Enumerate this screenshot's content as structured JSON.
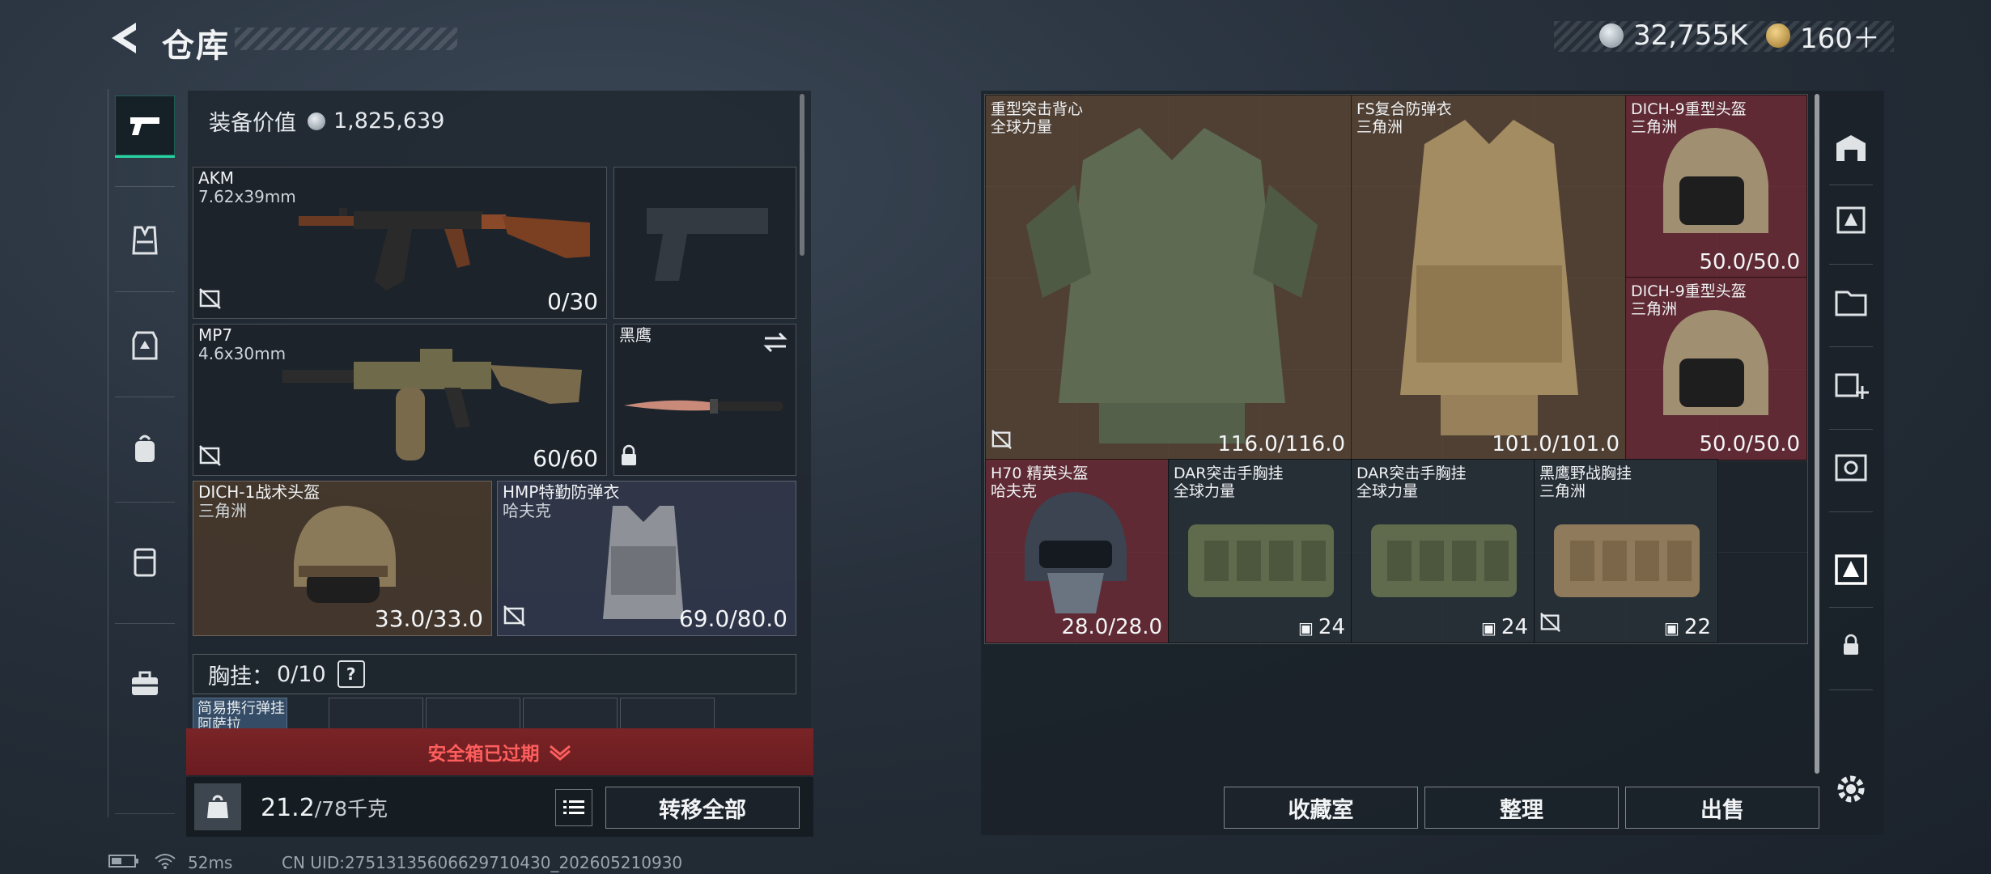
{
  "header": {
    "title": "仓库",
    "silver_amount": "32,755K",
    "gold_amount": "160＋"
  },
  "left_nav": {
    "items": [
      "gun-icon",
      "vest-icon",
      "armor-icon",
      "backpack-icon",
      "case-icon",
      "toolbox-icon"
    ],
    "active": "gun-icon"
  },
  "equipment": {
    "value_label": "装备价值",
    "value": "1,825,639",
    "primary": {
      "name": "AKM",
      "caliber": "7.62x39mm",
      "ammo": "0/30"
    },
    "secondary": {
      "name": "MP7",
      "caliber": "4.6x30mm",
      "ammo": "60/60"
    },
    "knife": {
      "name": "黑鹰"
    },
    "helmet": {
      "name": "DICH-1战术头盔",
      "faction": "三角洲",
      "durability": "33.0/33.0"
    },
    "armor": {
      "name": "HMP特勤防弹衣",
      "faction": "哈夫克",
      "durability": "69.0/80.0"
    },
    "chest_rig": {
      "label": "胸挂：",
      "count": "0/10",
      "help": "?"
    },
    "mini_slot_text": [
      "简易携行弹挂",
      "阿萨拉"
    ]
  },
  "safe_box": {
    "expired_text": "安全箱已过期"
  },
  "bottom": {
    "weight": "21.2",
    "weight_max": "/78千克",
    "transfer_all": "转移全部"
  },
  "storage": {
    "items": [
      {
        "name": "重型突击背心",
        "faction": "全球力量",
        "value": "116.0/116.0"
      },
      {
        "name": "FS复合防弹衣",
        "faction": "三角洲",
        "value": "101.0/101.0"
      },
      {
        "name": "DICH-9重型头盔",
        "faction": "三角洲",
        "value": "50.0/50.0"
      },
      {
        "name": "DICH-9重型头盔",
        "faction": "三角洲",
        "value": "50.0/50.0"
      },
      {
        "name": "H70 精英头盔",
        "faction": "哈夫克",
        "value": "28.0/28.0"
      },
      {
        "name": "DAR突击手胸挂",
        "faction": "全球力量",
        "value": "24"
      },
      {
        "name": "DAR突击手胸挂",
        "faction": "全球力量",
        "value": "24"
      },
      {
        "name": "黑鹰野战胸挂",
        "faction": "三角洲",
        "value": "22"
      }
    ],
    "buttons": {
      "collection": "收藏室",
      "organize": "整理",
      "sell": "出售"
    }
  },
  "status_bar": {
    "ping": "52ms",
    "uid": "CN UID:275131356066297104​30_202605210930"
  },
  "colors": {
    "accent": "#27d3a2",
    "expired": "#ff5e5e",
    "expired_bg": "#7a2426"
  }
}
